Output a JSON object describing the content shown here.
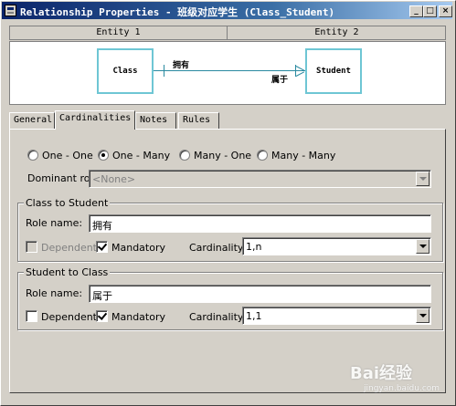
{
  "window": {
    "title": "Relationship Properties - 班级对应学生 (Class_Student)",
    "controls": {
      "minimize": "_",
      "maximize": "□",
      "close": "×"
    }
  },
  "entities": {
    "header": [
      "Entity 1",
      "Entity 2"
    ],
    "entity1": "Class",
    "entity2": "Student",
    "role_label_1": "拥有",
    "role_label_2": "属于",
    "line_color": "#2a8aa0",
    "box_border_color": "#6ec6d4"
  },
  "tabs": [
    {
      "label": "General",
      "active": false
    },
    {
      "label": "Cardinalities",
      "active": true
    },
    {
      "label": "Notes",
      "active": false
    },
    {
      "label": "Rules",
      "active": false
    }
  ],
  "cardinality_options": {
    "items": [
      "One - One",
      "One - Many",
      "Many - One",
      "Many - Many"
    ],
    "selected": "One - Many"
  },
  "dominant_role": {
    "label": "Dominant role:",
    "value": "<None>",
    "disabled": true
  },
  "class_to_student": {
    "title": "Class to Student",
    "role_name_label": "Role name:",
    "role_name_value": "拥有",
    "dependent_label": "Dependent",
    "dependent_checked": false,
    "dependent_disabled": true,
    "mandatory_label": "Mandatory",
    "mandatory_checked": true,
    "cardinality_label": "Cardinality:",
    "cardinality_value": "1,n"
  },
  "student_to_class": {
    "title": "Student to Class",
    "role_name_label": "Role name:",
    "role_name_value": "属于",
    "dependent_label": "Dependent",
    "dependent_checked": false,
    "dependent_disabled": false,
    "mandatory_label": "Mandatory",
    "mandatory_checked": true,
    "cardinality_label": "Cardinality:",
    "cardinality_value": "1,1"
  },
  "watermark": {
    "text": "Bai经验",
    "sub": "jingyan.baidu.com"
  }
}
